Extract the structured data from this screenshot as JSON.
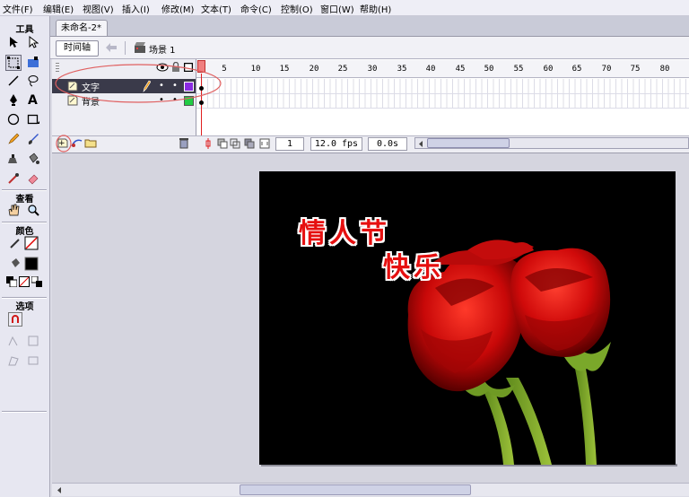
{
  "menu": [
    "文件(F)",
    "编辑(E)",
    "视图(V)",
    "插入(I)",
    "修改(M)",
    "文本(T)",
    "命令(C)",
    "控制(O)",
    "窗口(W)",
    "帮助(H)"
  ],
  "toolbox": {
    "tools_title": "工具",
    "view_title": "查看",
    "color_title": "颜色",
    "options_title": "选项"
  },
  "document": {
    "tab_title": "未命名-2*",
    "timeline_button": "时间轴",
    "scene_label": "场景 1"
  },
  "timeline": {
    "frame_numbers": [
      "1",
      "5",
      "10",
      "15",
      "20",
      "25",
      "30",
      "35",
      "40",
      "45",
      "50",
      "55",
      "60",
      "65",
      "70",
      "75",
      "80"
    ],
    "layers": [
      {
        "name": "文字",
        "selected": true,
        "color": "#8a2be2"
      },
      {
        "name": "背景",
        "selected": false,
        "color": "#22cc44"
      }
    ],
    "current_frame": "1",
    "frame_rate": "12.0 fps",
    "elapsed_time": "0.0s"
  },
  "stage": {
    "line1": "情人节",
    "line2": "快乐"
  },
  "colors": {
    "accent_annotation": "#e06060",
    "stage_background": "#000000",
    "text_red": "#e61010"
  }
}
